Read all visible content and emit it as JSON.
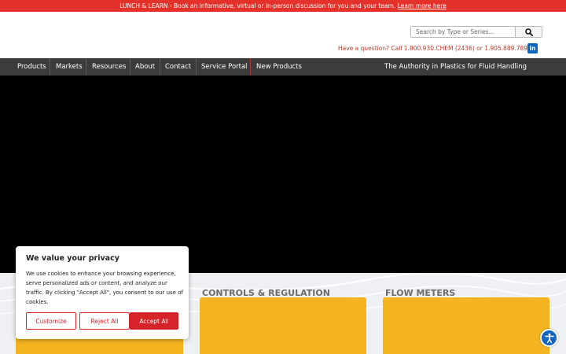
{
  "promo": {
    "text": "LUNCH & LEARN - Book an informative, virtual or in-person discussion for you and your team.",
    "link": "Learn more here"
  },
  "header": {
    "search_placeholder": "Search by Type or Series...",
    "search_icon": "search-icon",
    "phone": "Have a question? Call 1.800.930.CHEM (2436) or 1.905.889.7890",
    "linkedin_icon": "linkedin-icon",
    "linkedin_glyph": "in"
  },
  "nav": {
    "items": [
      "Products",
      "Markets",
      "Resources",
      "About",
      "Contact",
      "Service Portal",
      "New Products"
    ],
    "tagline": "The Authority in Plastics for Fluid Handling"
  },
  "categories": [
    {
      "title": "CONTROLS & REGULATION"
    },
    {
      "title": "FLOW METERS"
    }
  ],
  "cookie": {
    "title": "We value your privacy",
    "body": "We use cookies to enhance your browsing experience, serve personalized ads or content, and analyze our traffic. By clicking \"Accept All\", you consent to our use of cookies.",
    "customize": "Customize",
    "reject": "Reject All",
    "accept": "Accept All"
  },
  "accessibility_icon": "accessibility-icon",
  "colors": {
    "brand_red": "#e4322b",
    "nav_bg": "#3c3c3c",
    "card_yellow": "#f4b41f",
    "button_red": "#d6232a",
    "a11y_blue": "#1565c0"
  }
}
